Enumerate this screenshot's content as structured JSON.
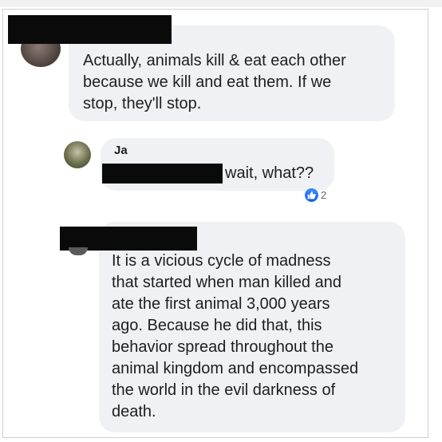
{
  "comments": [
    {
      "text": "Actually, animals kill & eat each other\nbecause we kill and eat them. If we\nstop, they'll stop."
    },
    {
      "author": "Ja",
      "text": "wait, what??",
      "reaction": {
        "icon": "like-icon",
        "count": "2"
      }
    },
    {
      "text": "It is a vicious cycle of madness\nthat started when man killed and\nate the first animal 3,000 years\nago. Because he did that, this\nbehavior spread throughout the\nanimal kingdom and encompassed\nthe world in the evil darkness of\ndeath."
    }
  ],
  "colors": {
    "bubble": "#eff1f4",
    "redaction": "#0a0a0a",
    "like_blue": "#1877f2"
  }
}
